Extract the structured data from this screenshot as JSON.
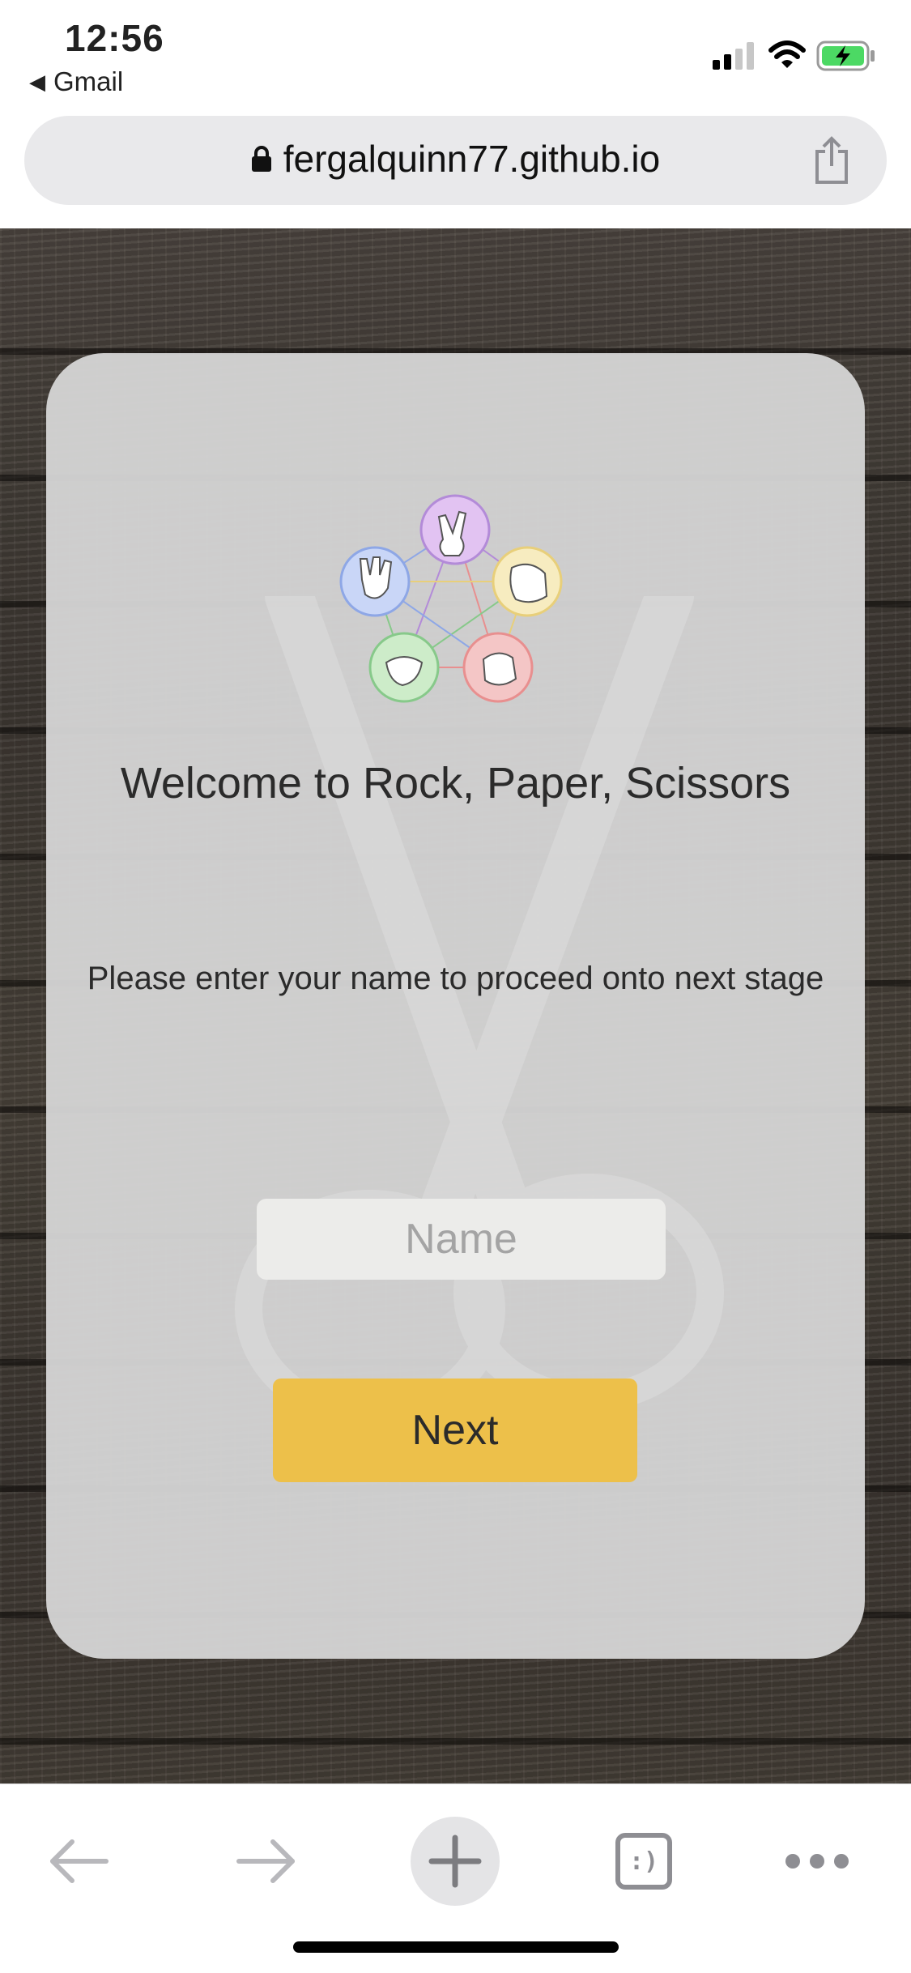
{
  "status_bar": {
    "time": "12:56",
    "back_app": "Gmail",
    "icons": [
      "cellular-signal-icon",
      "wifi-icon",
      "battery-charging-icon"
    ]
  },
  "browser": {
    "url": "fergalquinn77.github.io",
    "icons": [
      "lock-icon",
      "share-icon"
    ]
  },
  "page": {
    "welcome_title": "Welcome to Rock, Paper, Scissors",
    "instructions": "Please enter your name to proceed onto next stage",
    "name_placeholder": "Name",
    "name_value": "",
    "next_label": "Next",
    "accent_color": "#edc04a"
  },
  "toolbar": {
    "tabs_label": ":)",
    "icons": [
      "back-arrow-icon",
      "forward-arrow-icon",
      "plus-icon",
      "tabs-icon",
      "more-icon"
    ]
  }
}
